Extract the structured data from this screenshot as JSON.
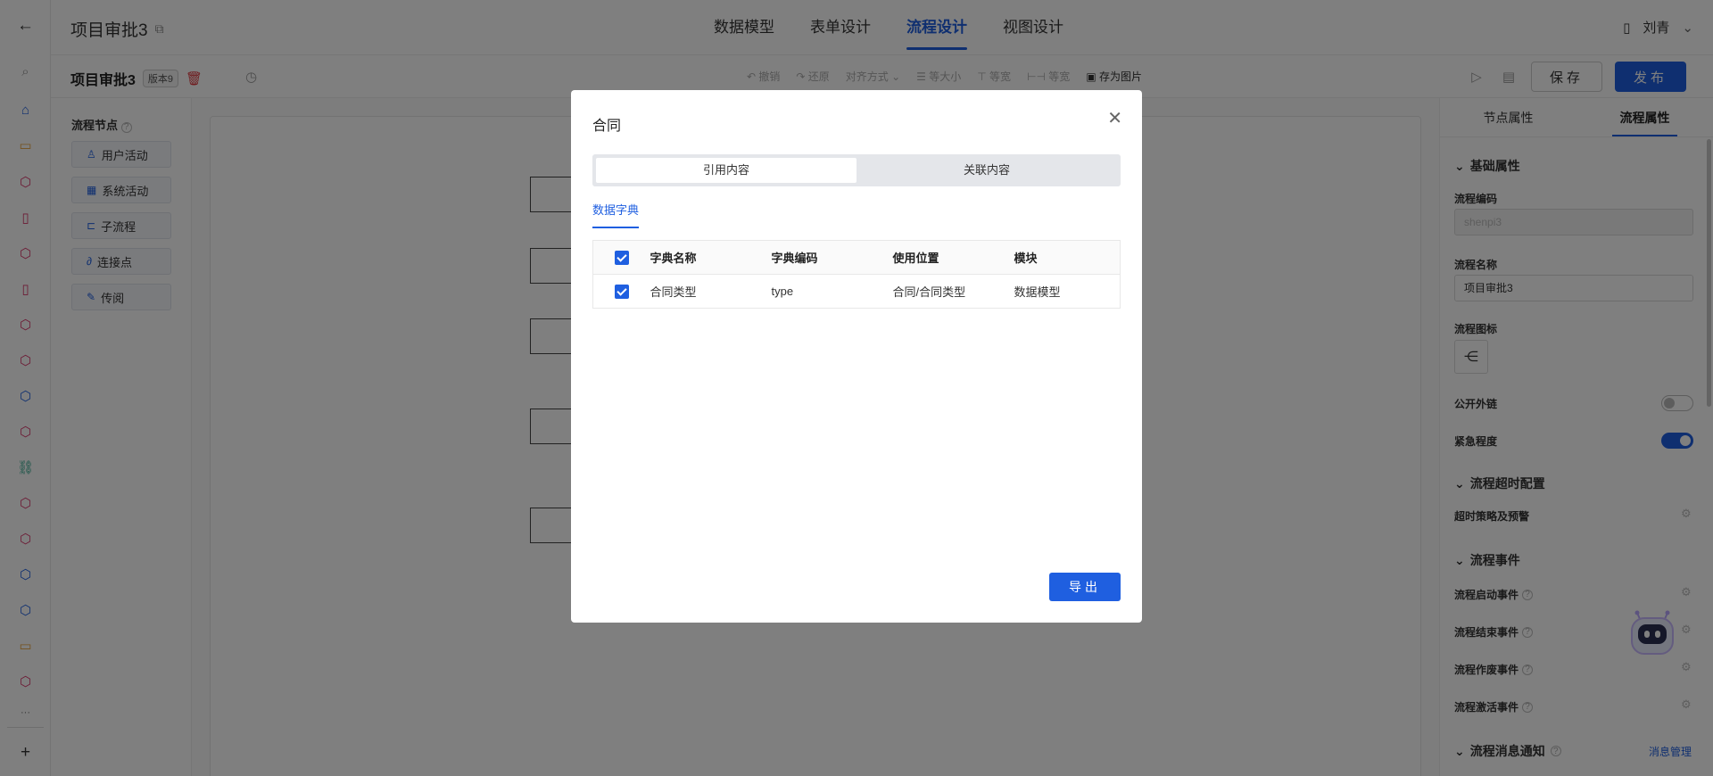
{
  "colors": {
    "primary": "#1f5fe0",
    "danger": "#e0393e",
    "overlay": "rgba(0,0,0,0.5)"
  },
  "rail": {
    "items": [
      {
        "icon": "back-arrow-icon",
        "glyph": "←",
        "color": "#333"
      },
      {
        "icon": "search-icon",
        "glyph": "⌕",
        "color": "#999"
      },
      {
        "icon": "home-icon",
        "glyph": "⌂",
        "color": "#1f5fe0"
      },
      {
        "icon": "chat-icon",
        "glyph": "▭",
        "color": "#e8a33c"
      },
      {
        "icon": "cube-icon",
        "glyph": "⬡",
        "color": "#d9366b"
      },
      {
        "icon": "document-icon",
        "glyph": "▯",
        "color": "#d9366b"
      },
      {
        "icon": "cube-icon",
        "glyph": "⬡",
        "color": "#d9366b"
      },
      {
        "icon": "document-icon",
        "glyph": "▯",
        "color": "#d9366b"
      },
      {
        "icon": "cube-icon",
        "glyph": "⬡",
        "color": "#d9366b"
      },
      {
        "icon": "cube-icon",
        "glyph": "⬡",
        "color": "#d9366b"
      },
      {
        "icon": "cube-icon",
        "glyph": "⬡",
        "color": "#1f5fe0"
      },
      {
        "icon": "cube-icon",
        "glyph": "⬡",
        "color": "#d9366b"
      },
      {
        "icon": "link-icon",
        "glyph": "⛓",
        "color": "#2aa58a"
      },
      {
        "icon": "cube-icon",
        "glyph": "⬡",
        "color": "#d9366b"
      },
      {
        "icon": "cube-icon",
        "glyph": "⬡",
        "color": "#d9366b"
      },
      {
        "icon": "cube-icon",
        "glyph": "⬡",
        "color": "#1f5fe0"
      },
      {
        "icon": "cube-icon",
        "glyph": "⬡",
        "color": "#1f5fe0"
      },
      {
        "icon": "chat-icon",
        "glyph": "▭",
        "color": "#e8a33c"
      },
      {
        "icon": "cube-icon",
        "glyph": "⬡",
        "color": "#d9366b"
      },
      {
        "icon": "more-icon",
        "glyph": "···",
        "color": "#666"
      },
      {
        "icon": "plus-icon",
        "glyph": "+",
        "color": "#333"
      }
    ]
  },
  "header": {
    "project_title": "项目审批3",
    "tabs": [
      {
        "label": "数据模型",
        "active": false
      },
      {
        "label": "表单设计",
        "active": false
      },
      {
        "label": "流程设计",
        "active": true
      },
      {
        "label": "视图设计",
        "active": false
      }
    ],
    "user_name": "刘青"
  },
  "toolbar": {
    "flow_name": "项目审批3",
    "version": "版本9",
    "tools": [
      {
        "label": "↶ 撤销",
        "enabled": false
      },
      {
        "label": "↷ 还原",
        "enabled": false
      },
      {
        "label": "对齐方式 ⌄",
        "enabled": false
      },
      {
        "label": "☰ 等大小",
        "enabled": false
      },
      {
        "label": "⊤ 等宽",
        "enabled": false
      },
      {
        "label": "⊢⊣ 等宽",
        "enabled": false
      },
      {
        "label": "▣ 存为图片",
        "enabled": true
      }
    ],
    "save_label": "保存",
    "publish_label": "发布"
  },
  "node_panel": {
    "title": "流程节点",
    "items": [
      {
        "label": "用户活动",
        "icon": "user-icon",
        "glyph": "♙"
      },
      {
        "label": "系统活动",
        "icon": "grid-icon",
        "glyph": "▦"
      },
      {
        "label": "子流程",
        "icon": "subflow-icon",
        "glyph": "⊏"
      },
      {
        "label": "连接点",
        "icon": "link-icon",
        "glyph": "∂"
      },
      {
        "label": "传阅",
        "icon": "edit-icon",
        "glyph": "✎"
      }
    ]
  },
  "props": {
    "tabs": [
      {
        "label": "节点属性",
        "active": false
      },
      {
        "label": "流程属性",
        "active": true
      }
    ],
    "section_basic": "基础属性",
    "code_label": "流程编码",
    "code_value": "shenpi3",
    "name_label": "流程名称",
    "name_value": "项目审批3",
    "icon_label": "流程图标",
    "public_label": "公开外链",
    "public_on": false,
    "urgency_label": "紧急程度",
    "urgency_on": true,
    "section_timeout": "流程超时配置",
    "timeout_label": "超时策略及预警",
    "section_events": "流程事件",
    "events": [
      "流程启动事件",
      "流程结束事件",
      "流程作废事件",
      "流程激活事件"
    ],
    "section_msg": "流程消息通知",
    "msg_link": "消息管理"
  },
  "modal": {
    "title": "合同",
    "segments": [
      {
        "label": "引用内容",
        "active": true
      },
      {
        "label": "关联内容",
        "active": false
      }
    ],
    "subtab": "数据字典",
    "columns": [
      "字典名称",
      "字典编码",
      "使用位置",
      "模块"
    ],
    "rows": [
      {
        "name": "合同类型",
        "code": "type",
        "location": "合同/合同类型",
        "module": "数据模型",
        "checked": true
      }
    ],
    "export_label": "导出"
  }
}
